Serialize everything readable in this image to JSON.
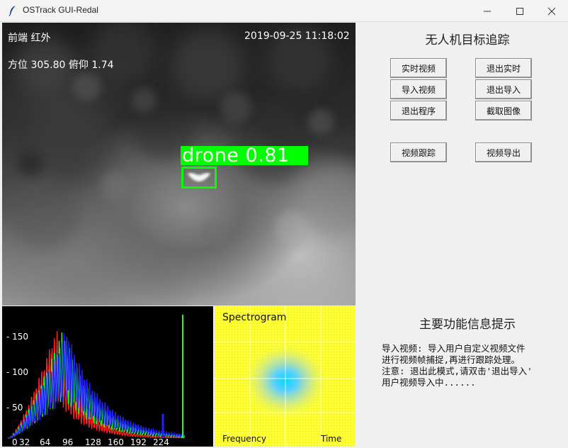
{
  "window": {
    "title": "OSTrack GUI-Redal"
  },
  "video": {
    "top_left": "前端  红外",
    "datetime": "2019-09-25  11:18:02",
    "angles": "方位 305.80   俯仰 1.74",
    "detection_label": "drone  0.81"
  },
  "histogram": {
    "y_ticks": [
      "- 150",
      "- 100",
      "- 50"
    ],
    "x_ticks": [
      "0",
      "32",
      "64",
      "96",
      "128",
      "160",
      "192",
      "224"
    ]
  },
  "spectrogram": {
    "title": "Spectrogram",
    "xlabel": "Frequency",
    "ylabel": "Time"
  },
  "controls": {
    "title": "无人机目标追踪",
    "buttons": {
      "realtime": "实时视频",
      "exit_realtime": "退出实时",
      "import": "导入视频",
      "exit_import": "退出导入",
      "quit": "退出程序",
      "capture": "截取图像",
      "track": "视频跟踪",
      "export": "视频导出"
    }
  },
  "info": {
    "title": "主要功能信息提示",
    "lines": [
      "导入视频: 导入用户自定义视频文件",
      "进行视频帧捕捉,再进行跟踪处理。",
      "注意: 退出此模式,请双击'退出导入'",
      "用户视频导入中......"
    ]
  },
  "colors": {
    "detection": "#00ff00",
    "spectrogram_bg": "#ffff33"
  }
}
